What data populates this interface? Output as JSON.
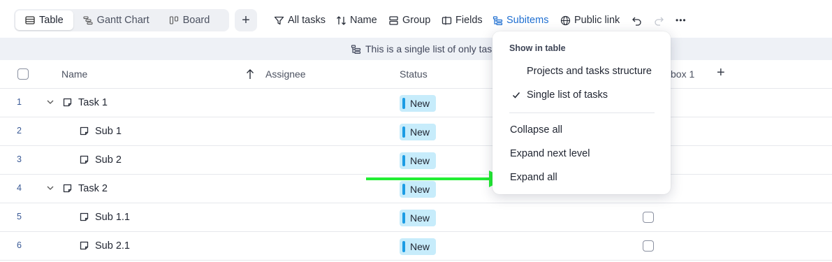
{
  "toolbar": {
    "views": [
      {
        "label": "Table",
        "icon": "table-icon",
        "active": true
      },
      {
        "label": "Gantt Chart",
        "icon": "gantt-icon",
        "active": false
      },
      {
        "label": "Board",
        "icon": "board-icon",
        "active": false
      }
    ],
    "add_view": "+",
    "all_tasks": "All tasks",
    "sort": "Name",
    "group": "Group",
    "fields": "Fields",
    "subitems": "Subitems",
    "public_link": "Public link",
    "more": "•••"
  },
  "banner": {
    "text": "This is a single list of only tas"
  },
  "table": {
    "headers": {
      "name": "Name",
      "assignee": "Assignee",
      "status": "Status",
      "checkbox": "box 1",
      "add": "+"
    },
    "rows": [
      {
        "num": "1",
        "name": "Task 1",
        "status": "New",
        "level": 0
      },
      {
        "num": "2",
        "name": "Sub 1",
        "status": "New",
        "level": 1
      },
      {
        "num": "3",
        "name": "Sub 2",
        "status": "New",
        "level": 1
      },
      {
        "num": "4",
        "name": "Task 2",
        "status": "New",
        "level": 0
      },
      {
        "num": "5",
        "name": "Sub 1.1",
        "status": "New",
        "level": 1
      },
      {
        "num": "6",
        "name": "Sub 2.1",
        "status": "New",
        "level": 1
      }
    ]
  },
  "menu": {
    "header": "Show in table",
    "structure_option": "Projects and tasks structure",
    "single_option": "Single list of tasks",
    "collapse_all": "Collapse all",
    "expand_next": "Expand next level",
    "expand_all": "Expand all"
  },
  "colors": {
    "accent": "#1f6fd1",
    "status_bg": "#c7ecfb",
    "status_bar": "#1c9ce4",
    "arrow": "#22ee33"
  }
}
